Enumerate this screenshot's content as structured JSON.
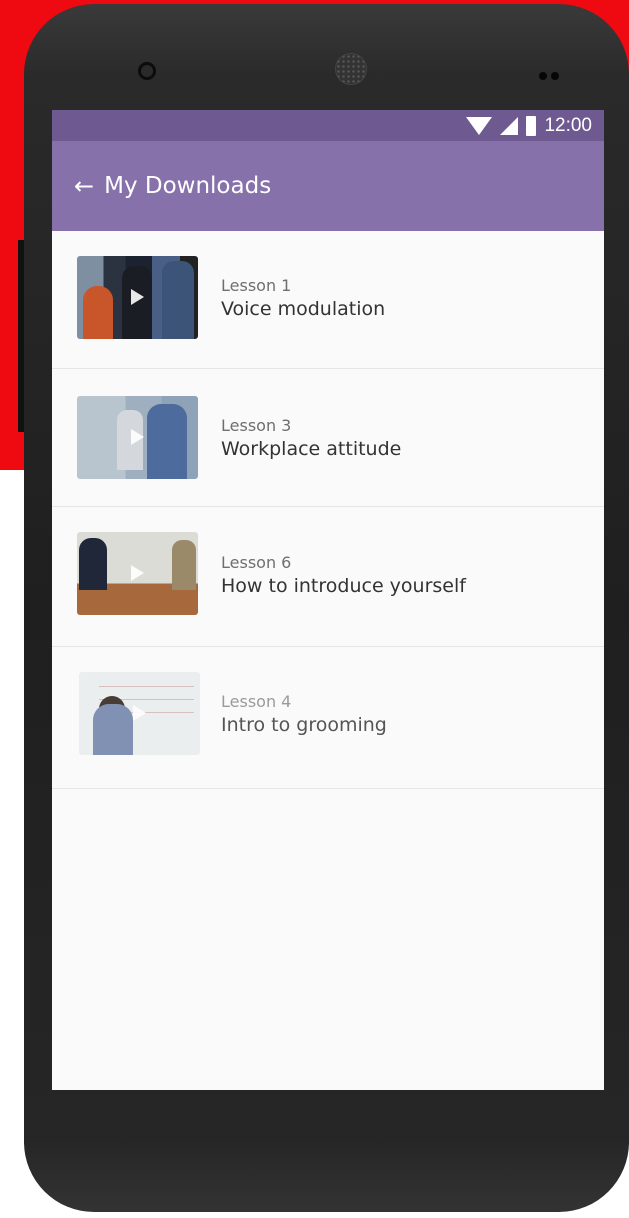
{
  "status_bar": {
    "time": "12:00",
    "icons": [
      "wifi-icon",
      "signal-icon",
      "battery-icon"
    ]
  },
  "app_bar": {
    "back_icon": "arrow-left-icon",
    "title": "My Downloads"
  },
  "colors": {
    "status_bar": "#6e5a91",
    "app_bar": "#8671ab",
    "background_accent": "#ee0a10",
    "screen_bg": "#fafafa"
  },
  "downloads": [
    {
      "lesson": "Lesson 1",
      "title": "Voice modulation"
    },
    {
      "lesson": "Lesson 3",
      "title": "Workplace attitude"
    },
    {
      "lesson": "Lesson 6",
      "title": "How to introduce yourself"
    },
    {
      "lesson": "Lesson 4",
      "title": "Intro to grooming"
    }
  ]
}
